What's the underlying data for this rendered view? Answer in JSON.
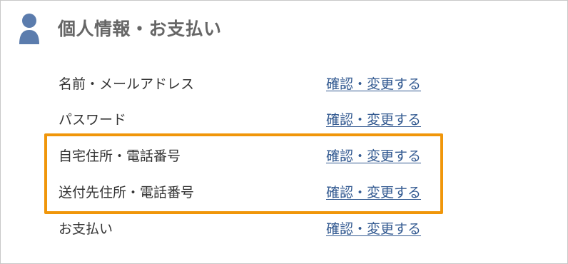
{
  "header": {
    "title": "個人情報・お支払い",
    "icon": "user-icon",
    "icon_color": "#5b7cad"
  },
  "rows": [
    {
      "label": "名前・メールアドレス",
      "link": "確認・変更する"
    },
    {
      "label": "パスワード",
      "link": "確認・変更する"
    },
    {
      "label": "自宅住所・電話番号",
      "link": "確認・変更する"
    },
    {
      "label": "送付先住所・電話番号",
      "link": "確認・変更する"
    },
    {
      "label": "お支払い",
      "link": "確認・変更する"
    }
  ],
  "colors": {
    "title": "#666666",
    "label": "#333333",
    "link": "#335a91",
    "highlight": "#f0960a",
    "border": "#c8c8c8"
  }
}
